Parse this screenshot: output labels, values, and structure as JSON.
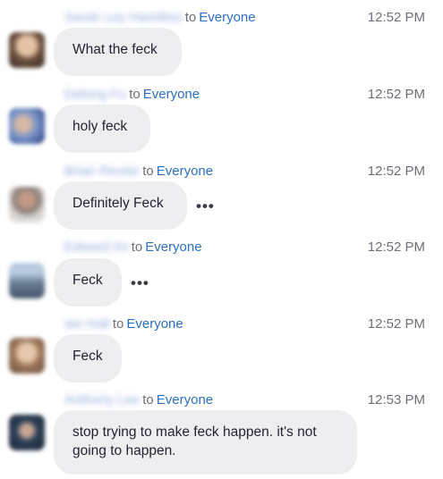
{
  "messages": [
    {
      "sender": "Sarah Ley Hamilton",
      "to_label": "to",
      "recipient": "Everyone",
      "time": "12:52 PM",
      "text": "What the feck",
      "avatar_color": "#8a6f5c"
    },
    {
      "sender": "Delong Fu",
      "to_label": "to",
      "recipient": "Everyone",
      "time": "12:52 PM",
      "text": "holy feck",
      "avatar_color": "#5f7fb8"
    },
    {
      "sender": "Brian Reuter",
      "to_label": "to",
      "recipient": "Everyone",
      "time": "12:52 PM",
      "text": "Definitely Feck",
      "more_icon": "•••",
      "avatar_color": "#b2a89f"
    },
    {
      "sender": "Edward Im",
      "to_label": "to",
      "recipient": "Everyone",
      "time": "12:52 PM",
      "text": "Feck",
      "more_icon": "•••",
      "avatar_color": "#7d97b0"
    },
    {
      "sender": "Ian Hall",
      "to_label": "to",
      "recipient": "Everyone",
      "time": "12:52 PM",
      "text": "Feck",
      "avatar_color": "#b08f78"
    },
    {
      "sender": "Anthony Lee",
      "to_label": "to",
      "recipient": "Everyone",
      "time": "12:53 PM",
      "text_line1": "stop trying to make feck happen. it's not",
      "text_line2": "going to happen.",
      "avatar_color": "#23344a"
    }
  ]
}
